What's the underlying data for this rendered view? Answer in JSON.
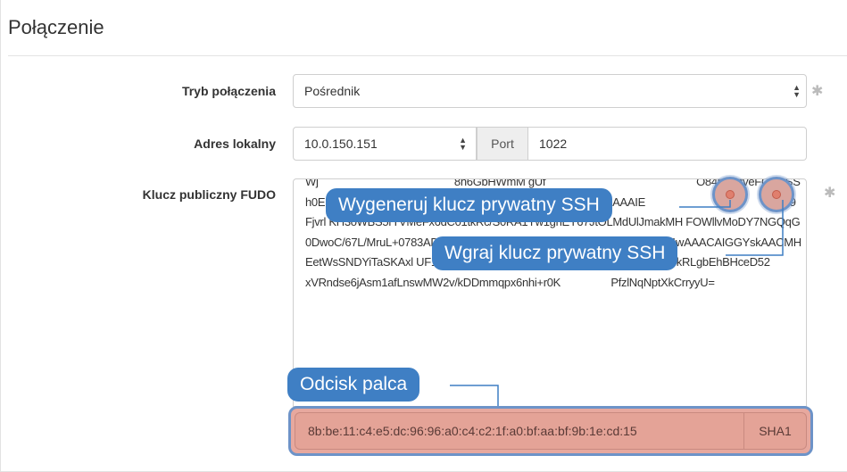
{
  "section": {
    "title": "Połączenie"
  },
  "form": {
    "mode": {
      "label": "Tryb połączenia",
      "value": "Pośrednik"
    },
    "local_address": {
      "label": "Adres lokalny",
      "value": "10.0.150.151",
      "port_label": "Port",
      "port_value": "1022"
    },
    "public_key": {
      "label": "Klucz publiczny FUDO",
      "text": "Wj                                              8n6GbHWmM gUf                                                   O84pF/MveFOb 9SSh0ED9BGcwt                                              YL6okb5 2MckzjReQAAAIE                                          saj89Fjvrl KH3oWBS5rTVMeFx6dC01tkRc/S0RA1Yw1gnEY67JtOLMdUlJmakMH FOWllvMoDY7NGQqG0DwoC/67L/MruL+0783ADnYSKgvaQlfdDdT5UN gkG/eGFDJbwYDjGYBf4wAAACAIGGYskAACMHEetWsSNDYiTaSKAxl UF1yZgBiwYvDyZAVBXvA+1H5Lm+B3086p9Rj+5BrkRLgbEhBHceD52              xVRndse6jAsm1afLnswMW2v/kDDmmqpx6nhi+r0K                 PfzlNqNptXkCrryyU="
    },
    "fingerprint": {
      "value": "8b:be:11:c4:e5:dc:96:96:a0:c4:c2:1f:a0:bf:aa:bf:9b:1e:cd:15",
      "algorithm": "SHA1"
    },
    "required_marker": "✱"
  },
  "callouts": {
    "generate": "Wygeneruj klucz prywatny SSH",
    "upload": "Wgraj klucz prywatny SSH",
    "fingerprint": "Odcisk palca"
  }
}
